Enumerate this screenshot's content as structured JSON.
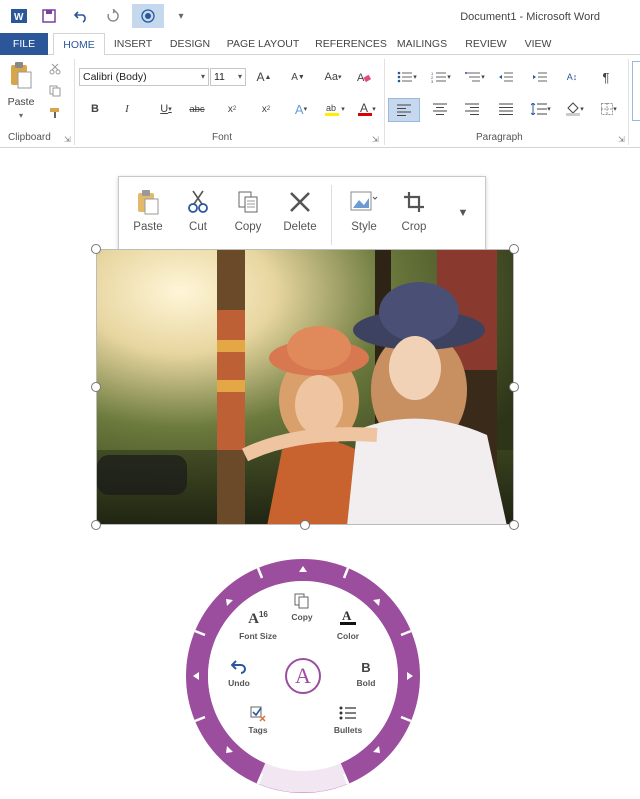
{
  "window": {
    "title": "Document1 - Microsoft Word"
  },
  "tabs": [
    "FILE",
    "HOME",
    "INSERT",
    "DESIGN",
    "PAGE LAYOUT",
    "REFERENCES",
    "MAILINGS",
    "REVIEW",
    "VIEW"
  ],
  "ribbon": {
    "clipboard": {
      "paste_label": "Paste",
      "group_label": "Clipboard"
    },
    "font": {
      "font_name": "Calibri (Body)",
      "font_size": "11",
      "group_label": "Font"
    },
    "paragraph": {
      "group_label": "Paragraph"
    }
  },
  "mini_toolbar": {
    "paste": "Paste",
    "cut": "Cut",
    "copy": "Copy",
    "delete": "Delete",
    "style": "Style",
    "crop": "Crop"
  },
  "radial_menu": {
    "copy": "Copy",
    "font_size": "Font Size",
    "font_size_value": "16",
    "color": "Color",
    "undo": "Undo",
    "bold": "Bold",
    "tags": "Tags",
    "bullets": "Bullets",
    "center_glyph": "A",
    "accent": "#9c4e9e",
    "accent_light": "#f2e6f2"
  }
}
